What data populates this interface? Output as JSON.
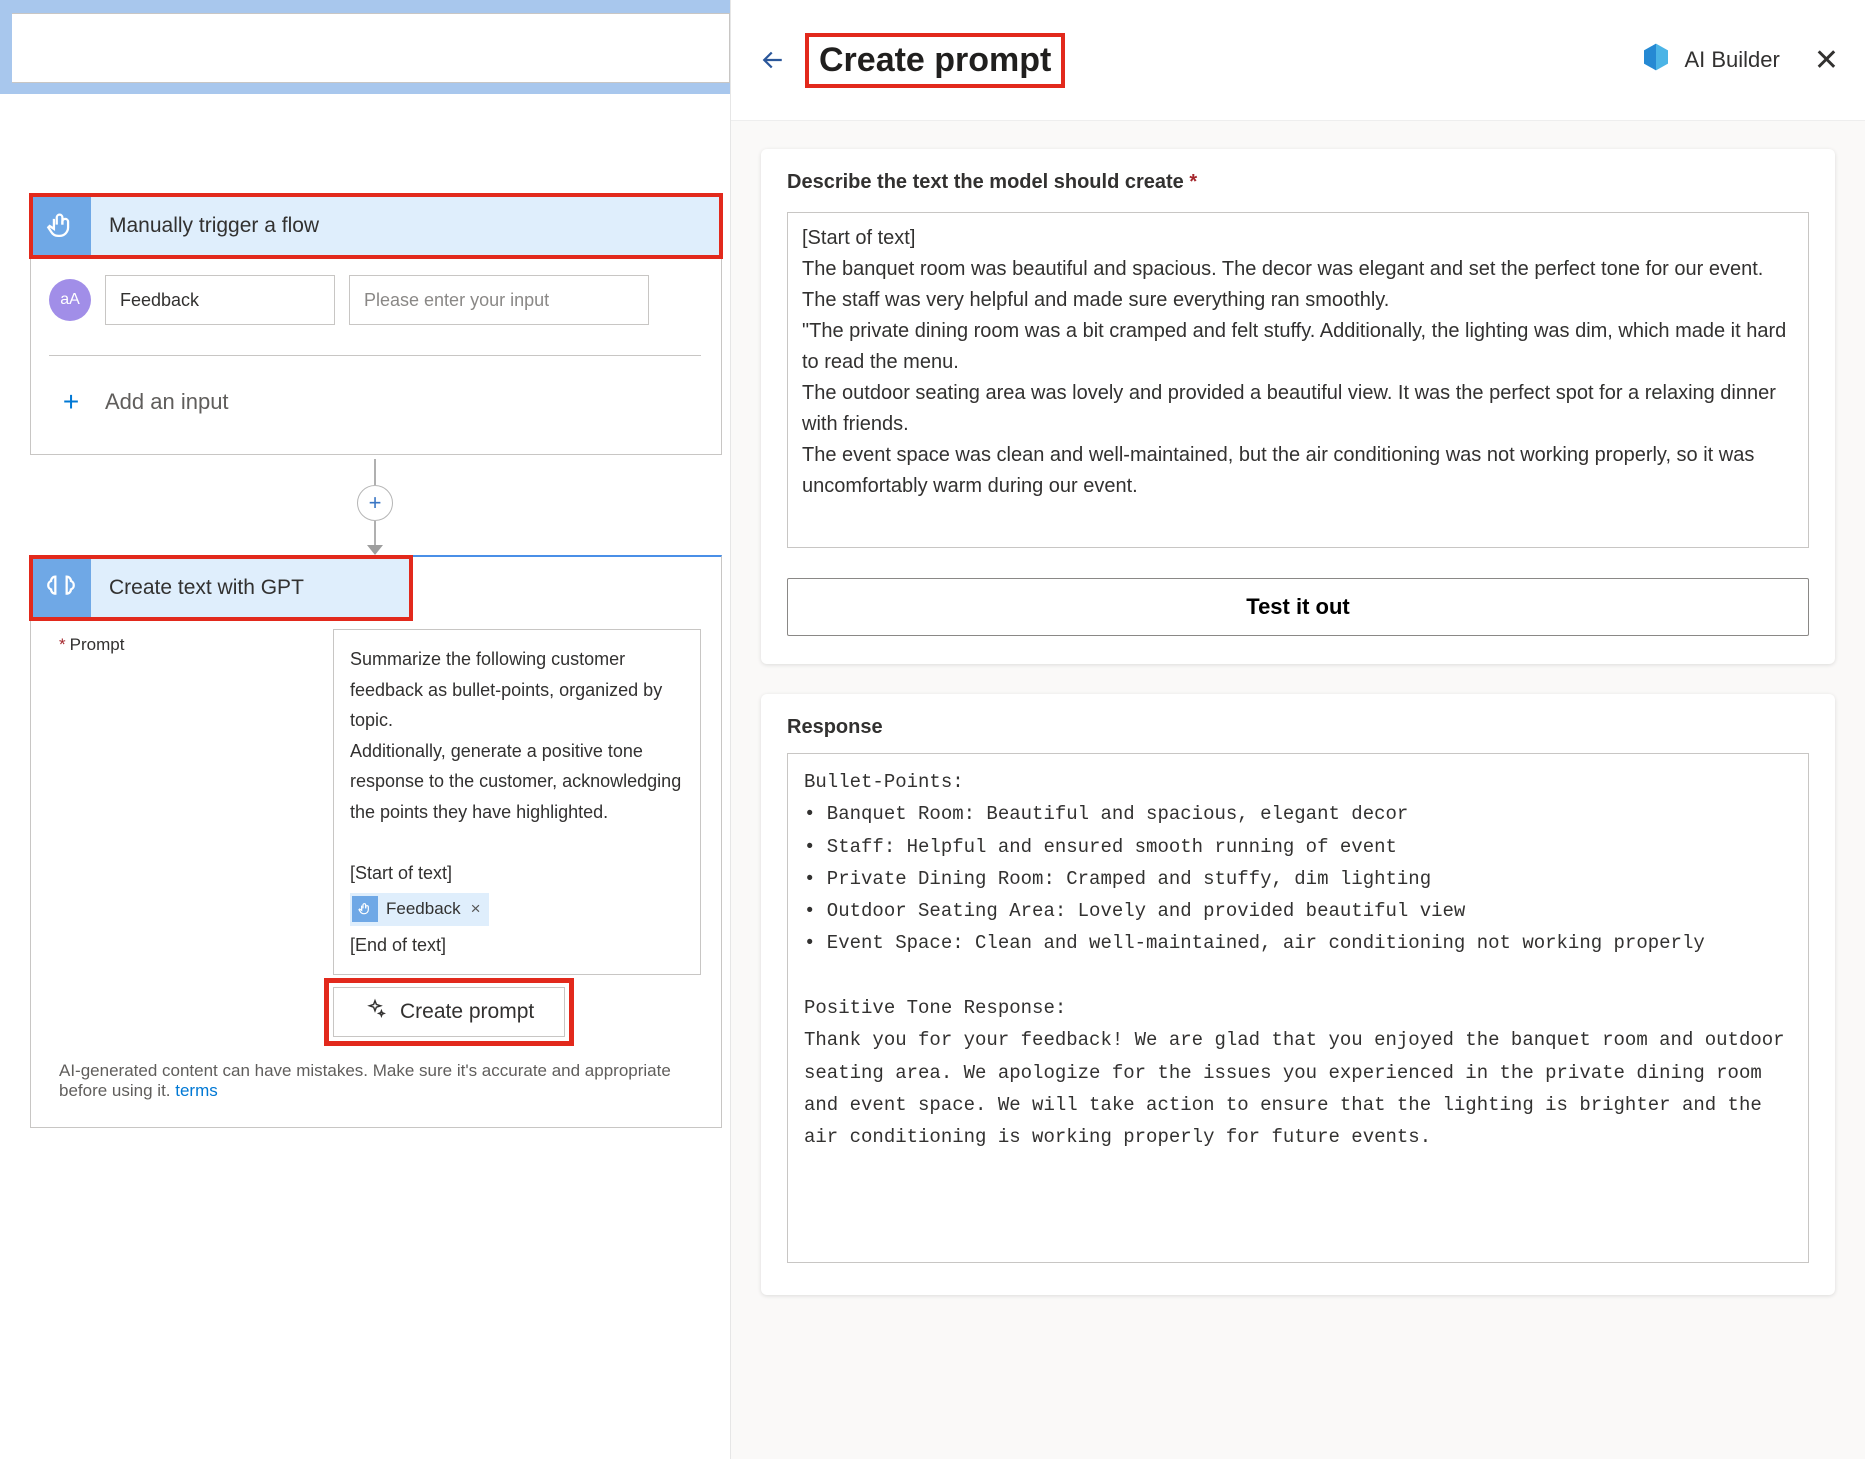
{
  "flow": {
    "trigger": {
      "title": "Manually trigger a flow",
      "param_name": "Feedback",
      "param_placeholder": "Please enter your input",
      "add_input_label": "Add an input"
    },
    "action": {
      "title": "Create text with GPT",
      "field_label": "Prompt",
      "prompt_text_line1": "Summarize the following customer feedback as bullet-points, organized by topic.",
      "prompt_text_line2": "Additionally, generate a positive tone response to the customer, acknowledging the points they have highlighted.",
      "start_marker": "[Start of text]",
      "end_marker": "[End of text]",
      "chip_label": "Feedback",
      "create_prompt_btn": "Create prompt",
      "ai_note_text": "AI-generated content can have mistakes. Make sure it's accurate and appropriate before using it. ",
      "ai_note_link": "terms"
    }
  },
  "panel": {
    "title": "Create prompt",
    "brand": "AI Builder",
    "describe_label": "Describe the text the model should create",
    "describe_text": "[Start of text]\nThe banquet room was beautiful and spacious. The decor was elegant and set the perfect tone for our event. The staff was very helpful and made sure everything ran smoothly.\n\"The private dining room was a bit cramped and felt stuffy. Additionally, the lighting was dim, which made it hard to read the menu.\nThe outdoor seating area was lovely and provided a beautiful view. It was the perfect spot for a relaxing dinner with friends.\nThe event space was clean and well-maintained, but the air conditioning was not working properly, so it was uncomfortably warm during our event.",
    "test_btn": "Test it out",
    "response_label": "Response",
    "response_text": "Bullet-Points:\n• Banquet Room: Beautiful and spacious, elegant decor\n• Staff: Helpful and ensured smooth running of event\n• Private Dining Room: Cramped and stuffy, dim lighting\n• Outdoor Seating Area: Lovely and provided beautiful view\n• Event Space: Clean and well-maintained, air conditioning not working properly\n\nPositive Tone Response:\nThank you for your feedback! We are glad that you enjoyed the banquet room and outdoor seating area. We apologize for the issues you experienced in the private dining room and event space. We will take action to ensure that the lighting is brighter and the air conditioning is working properly for future events."
  }
}
